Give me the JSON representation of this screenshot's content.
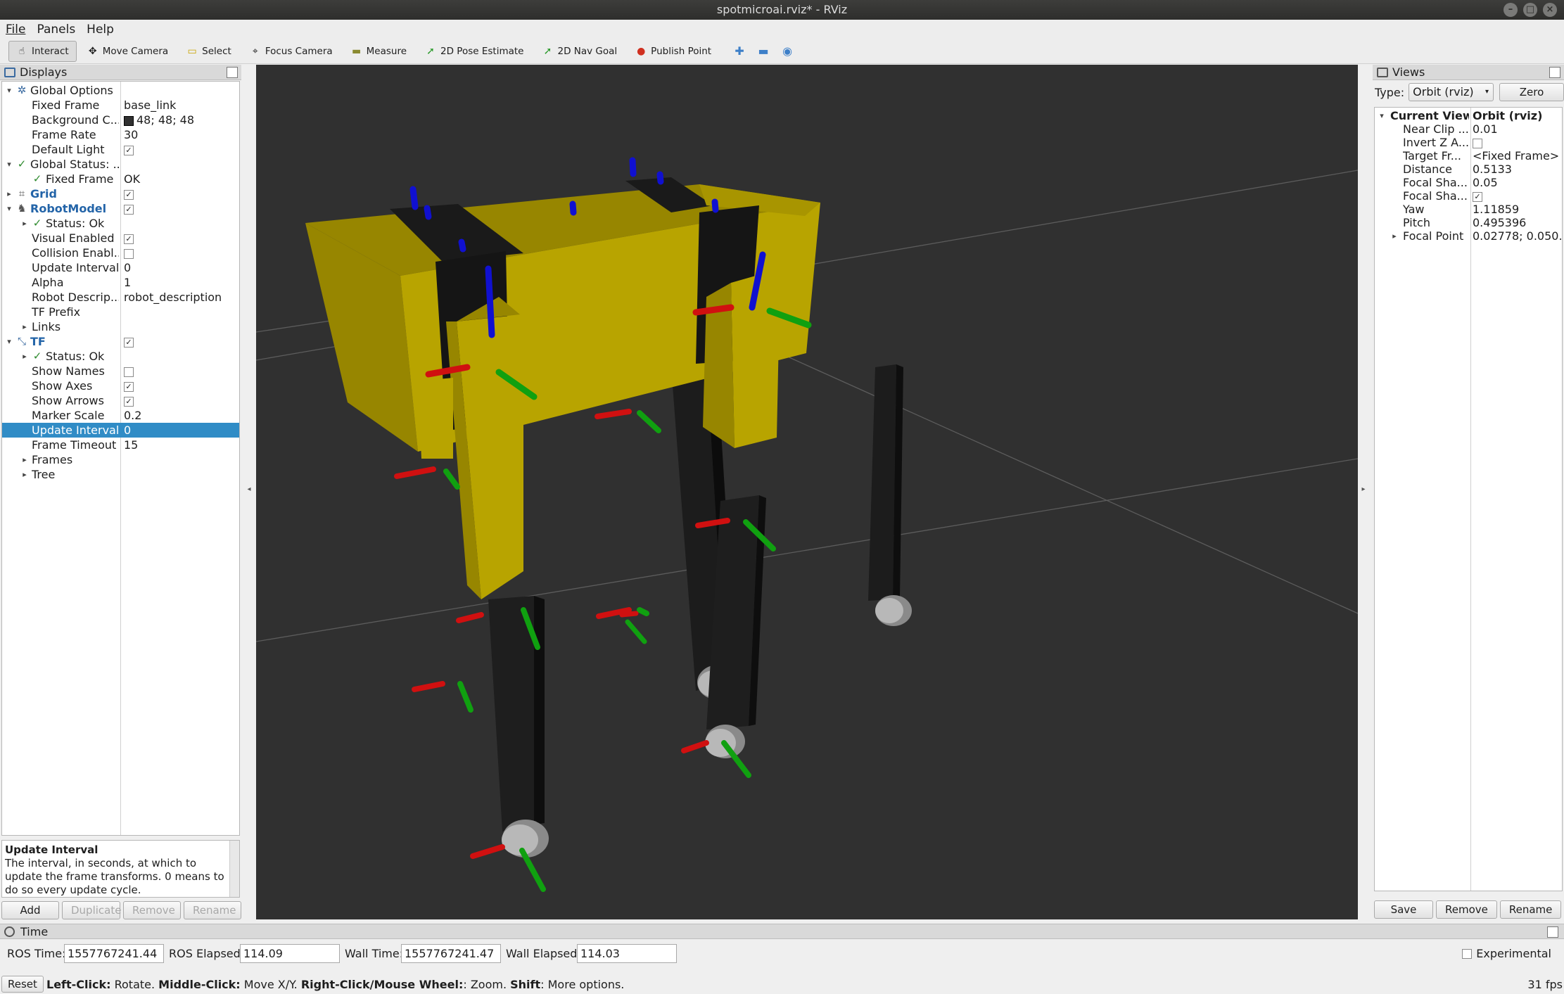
{
  "window": {
    "title": "spotmicroai.rviz* - RViz"
  },
  "menu": [
    "File",
    "Panels",
    "Help"
  ],
  "toolbar": {
    "tools": [
      {
        "label": "Interact",
        "icon": "interact-icon",
        "active": true
      },
      {
        "label": "Move Camera",
        "icon": "move-camera-icon",
        "active": false
      },
      {
        "label": "Select",
        "icon": "select-icon",
        "active": false
      },
      {
        "label": "Focus Camera",
        "icon": "focus-camera-icon",
        "active": false
      },
      {
        "label": "Measure",
        "icon": "measure-icon",
        "active": false
      },
      {
        "label": "2D Pose Estimate",
        "icon": "pose-estimate-icon",
        "active": false
      },
      {
        "label": "2D Nav Goal",
        "icon": "nav-goal-icon",
        "active": false
      },
      {
        "label": "Publish Point",
        "icon": "publish-point-icon",
        "active": false
      }
    ],
    "extra_icons": [
      "add-tool-icon",
      "remove-tool-icon",
      "view-menu-icon"
    ]
  },
  "displays": {
    "title": "Displays",
    "rows": [
      {
        "label": "Global Options",
        "value": "",
        "depth": 0,
        "expand": "open",
        "icon": "gear-icon"
      },
      {
        "label": "Fixed Frame",
        "value": "base_link",
        "depth": 1
      },
      {
        "label": "Background C...",
        "value": "48; 48; 48",
        "depth": 1,
        "swatch": "#303030"
      },
      {
        "label": "Frame Rate",
        "value": "30",
        "depth": 1
      },
      {
        "label": "Default Light",
        "value": "",
        "depth": 1,
        "check": true
      },
      {
        "label": "Global Status: ...",
        "value": "",
        "depth": 0,
        "expand": "open",
        "icon": "ok-icon"
      },
      {
        "label": "Fixed Frame",
        "value": "OK",
        "depth": 1,
        "icon": "ok-icon"
      },
      {
        "label": "Grid",
        "value": "",
        "depth": 0,
        "expand": "closed",
        "icon": "grid-icon",
        "plugin": true,
        "check": true
      },
      {
        "label": "RobotModel",
        "value": "",
        "depth": 0,
        "expand": "open",
        "icon": "robot-icon",
        "plugin": true,
        "check": true
      },
      {
        "label": "Status: Ok",
        "value": "",
        "depth": 1,
        "expand": "closed",
        "icon": "ok-icon"
      },
      {
        "label": "Visual Enabled",
        "value": "",
        "depth": 1,
        "check": true
      },
      {
        "label": "Collision Enabl...",
        "value": "",
        "depth": 1,
        "check": false
      },
      {
        "label": "Update Interval",
        "value": "0",
        "depth": 1
      },
      {
        "label": "Alpha",
        "value": "1",
        "depth": 1
      },
      {
        "label": "Robot Descrip...",
        "value": "robot_description",
        "depth": 1
      },
      {
        "label": "TF Prefix",
        "value": "",
        "depth": 1
      },
      {
        "label": "Links",
        "value": "",
        "depth": 1,
        "expand": "closed"
      },
      {
        "label": "TF",
        "value": "",
        "depth": 0,
        "expand": "open",
        "icon": "tf-icon",
        "plugin": true,
        "check": true
      },
      {
        "label": "Status: Ok",
        "value": "",
        "depth": 1,
        "expand": "closed",
        "icon": "ok-icon"
      },
      {
        "label": "Show Names",
        "value": "",
        "depth": 1,
        "check": false
      },
      {
        "label": "Show Axes",
        "value": "",
        "depth": 1,
        "check": true
      },
      {
        "label": "Show Arrows",
        "value": "",
        "depth": 1,
        "check": true
      },
      {
        "label": "Marker Scale",
        "value": "0.2",
        "depth": 1
      },
      {
        "label": "Update Interval",
        "value": "0",
        "depth": 1,
        "selected": true
      },
      {
        "label": "Frame Timeout",
        "value": "15",
        "depth": 1
      },
      {
        "label": "Frames",
        "value": "",
        "depth": 1,
        "expand": "closed"
      },
      {
        "label": "Tree",
        "value": "",
        "depth": 1,
        "expand": "closed"
      }
    ],
    "description_title": "Update Interval",
    "description_text": "The interval, in seconds, at which to update the frame transforms. 0 means to do so every update cycle.",
    "buttons": [
      {
        "label": "Add",
        "enabled": true
      },
      {
        "label": "Duplicate",
        "enabled": false
      },
      {
        "label": "Remove",
        "enabled": false
      },
      {
        "label": "Rename",
        "enabled": false
      }
    ]
  },
  "views": {
    "title": "Views",
    "type_label": "Type:",
    "type_value": "Orbit (rviz)",
    "zero_label": "Zero",
    "rows": [
      {
        "label": "Current View",
        "value": "Orbit (rviz)",
        "depth": 0,
        "expand": "open",
        "bold": true
      },
      {
        "label": "Near Clip ...",
        "value": "0.01",
        "depth": 1
      },
      {
        "label": "Invert Z A...",
        "value": "",
        "depth": 1,
        "check": false
      },
      {
        "label": "Target Fr...",
        "value": "<Fixed Frame>",
        "depth": 1
      },
      {
        "label": "Distance",
        "value": "0.5133",
        "depth": 1
      },
      {
        "label": "Focal Sha...",
        "value": "0.05",
        "depth": 1
      },
      {
        "label": "Focal Sha...",
        "value": "",
        "depth": 1,
        "check": true
      },
      {
        "label": "Yaw",
        "value": "1.11859",
        "depth": 1
      },
      {
        "label": "Pitch",
        "value": "0.495396",
        "depth": 1
      },
      {
        "label": "Focal Point",
        "value": "0.02778; 0.050...",
        "depth": 1,
        "expand": "closed"
      }
    ],
    "buttons": [
      "Save",
      "Remove",
      "Rename"
    ]
  },
  "time": {
    "title": "Time",
    "ros_time_label": "ROS Time:",
    "ros_time": "1557767241.44",
    "ros_elapsed_label": "ROS Elapsed:",
    "ros_elapsed": "114.09",
    "wall_time_label": "Wall Time:",
    "wall_time": "1557767241.47",
    "wall_elapsed_label": "Wall Elapsed:",
    "wall_elapsed": "114.03",
    "experimental_label": "Experimental"
  },
  "status": {
    "reset_label": "Reset",
    "hint": [
      {
        "text": "Left-Click:",
        "bold": true
      },
      {
        "text": " Rotate. ",
        "bold": false
      },
      {
        "text": "Middle-Click:",
        "bold": true
      },
      {
        "text": " Move X/Y. ",
        "bold": false
      },
      {
        "text": "Right-Click/Mouse Wheel:",
        "bold": true
      },
      {
        "text": ": Zoom. ",
        "bold": false
      },
      {
        "text": "Shift",
        "bold": true
      },
      {
        "text": ": More options.",
        "bold": false
      }
    ],
    "fps": "31 fps"
  },
  "scene": {
    "background": "#303030",
    "body_color": "#b8a400",
    "leg_color": "#1a1a1a",
    "axis_x_color": "#d01010",
    "axis_y_color": "#10a010",
    "axis_z_color": "#1010d0"
  }
}
